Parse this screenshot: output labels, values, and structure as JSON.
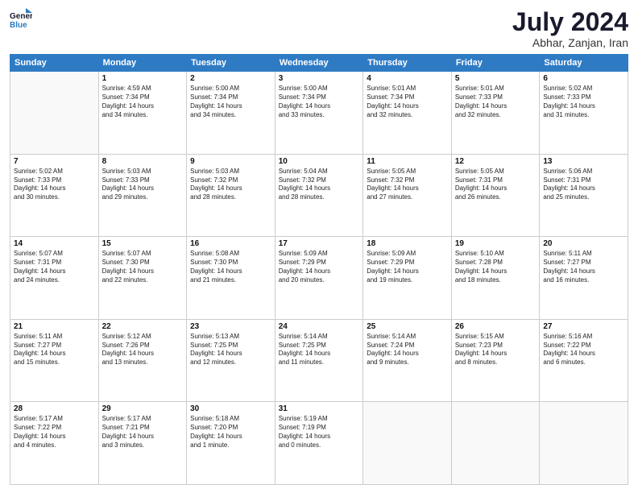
{
  "header": {
    "logo_line1": "General",
    "logo_line2": "Blue",
    "month_year": "July 2024",
    "location": "Abhar, Zanjan, Iran"
  },
  "days_of_week": [
    "Sunday",
    "Monday",
    "Tuesday",
    "Wednesday",
    "Thursday",
    "Friday",
    "Saturday"
  ],
  "weeks": [
    [
      {
        "day": "",
        "info": ""
      },
      {
        "day": "1",
        "info": "Sunrise: 4:59 AM\nSunset: 7:34 PM\nDaylight: 14 hours\nand 34 minutes."
      },
      {
        "day": "2",
        "info": "Sunrise: 5:00 AM\nSunset: 7:34 PM\nDaylight: 14 hours\nand 34 minutes."
      },
      {
        "day": "3",
        "info": "Sunrise: 5:00 AM\nSunset: 7:34 PM\nDaylight: 14 hours\nand 33 minutes."
      },
      {
        "day": "4",
        "info": "Sunrise: 5:01 AM\nSunset: 7:34 PM\nDaylight: 14 hours\nand 32 minutes."
      },
      {
        "day": "5",
        "info": "Sunrise: 5:01 AM\nSunset: 7:33 PM\nDaylight: 14 hours\nand 32 minutes."
      },
      {
        "day": "6",
        "info": "Sunrise: 5:02 AM\nSunset: 7:33 PM\nDaylight: 14 hours\nand 31 minutes."
      }
    ],
    [
      {
        "day": "7",
        "info": "Sunrise: 5:02 AM\nSunset: 7:33 PM\nDaylight: 14 hours\nand 30 minutes."
      },
      {
        "day": "8",
        "info": "Sunrise: 5:03 AM\nSunset: 7:33 PM\nDaylight: 14 hours\nand 29 minutes."
      },
      {
        "day": "9",
        "info": "Sunrise: 5:03 AM\nSunset: 7:32 PM\nDaylight: 14 hours\nand 28 minutes."
      },
      {
        "day": "10",
        "info": "Sunrise: 5:04 AM\nSunset: 7:32 PM\nDaylight: 14 hours\nand 28 minutes."
      },
      {
        "day": "11",
        "info": "Sunrise: 5:05 AM\nSunset: 7:32 PM\nDaylight: 14 hours\nand 27 minutes."
      },
      {
        "day": "12",
        "info": "Sunrise: 5:05 AM\nSunset: 7:31 PM\nDaylight: 14 hours\nand 26 minutes."
      },
      {
        "day": "13",
        "info": "Sunrise: 5:06 AM\nSunset: 7:31 PM\nDaylight: 14 hours\nand 25 minutes."
      }
    ],
    [
      {
        "day": "14",
        "info": "Sunrise: 5:07 AM\nSunset: 7:31 PM\nDaylight: 14 hours\nand 24 minutes."
      },
      {
        "day": "15",
        "info": "Sunrise: 5:07 AM\nSunset: 7:30 PM\nDaylight: 14 hours\nand 22 minutes."
      },
      {
        "day": "16",
        "info": "Sunrise: 5:08 AM\nSunset: 7:30 PM\nDaylight: 14 hours\nand 21 minutes."
      },
      {
        "day": "17",
        "info": "Sunrise: 5:09 AM\nSunset: 7:29 PM\nDaylight: 14 hours\nand 20 minutes."
      },
      {
        "day": "18",
        "info": "Sunrise: 5:09 AM\nSunset: 7:29 PM\nDaylight: 14 hours\nand 19 minutes."
      },
      {
        "day": "19",
        "info": "Sunrise: 5:10 AM\nSunset: 7:28 PM\nDaylight: 14 hours\nand 18 minutes."
      },
      {
        "day": "20",
        "info": "Sunrise: 5:11 AM\nSunset: 7:27 PM\nDaylight: 14 hours\nand 16 minutes."
      }
    ],
    [
      {
        "day": "21",
        "info": "Sunrise: 5:11 AM\nSunset: 7:27 PM\nDaylight: 14 hours\nand 15 minutes."
      },
      {
        "day": "22",
        "info": "Sunrise: 5:12 AM\nSunset: 7:26 PM\nDaylight: 14 hours\nand 13 minutes."
      },
      {
        "day": "23",
        "info": "Sunrise: 5:13 AM\nSunset: 7:25 PM\nDaylight: 14 hours\nand 12 minutes."
      },
      {
        "day": "24",
        "info": "Sunrise: 5:14 AM\nSunset: 7:25 PM\nDaylight: 14 hours\nand 11 minutes."
      },
      {
        "day": "25",
        "info": "Sunrise: 5:14 AM\nSunset: 7:24 PM\nDaylight: 14 hours\nand 9 minutes."
      },
      {
        "day": "26",
        "info": "Sunrise: 5:15 AM\nSunset: 7:23 PM\nDaylight: 14 hours\nand 8 minutes."
      },
      {
        "day": "27",
        "info": "Sunrise: 5:16 AM\nSunset: 7:22 PM\nDaylight: 14 hours\nand 6 minutes."
      }
    ],
    [
      {
        "day": "28",
        "info": "Sunrise: 5:17 AM\nSunset: 7:22 PM\nDaylight: 14 hours\nand 4 minutes."
      },
      {
        "day": "29",
        "info": "Sunrise: 5:17 AM\nSunset: 7:21 PM\nDaylight: 14 hours\nand 3 minutes."
      },
      {
        "day": "30",
        "info": "Sunrise: 5:18 AM\nSunset: 7:20 PM\nDaylight: 14 hours\nand 1 minute."
      },
      {
        "day": "31",
        "info": "Sunrise: 5:19 AM\nSunset: 7:19 PM\nDaylight: 14 hours\nand 0 minutes."
      },
      {
        "day": "",
        "info": ""
      },
      {
        "day": "",
        "info": ""
      },
      {
        "day": "",
        "info": ""
      }
    ]
  ]
}
